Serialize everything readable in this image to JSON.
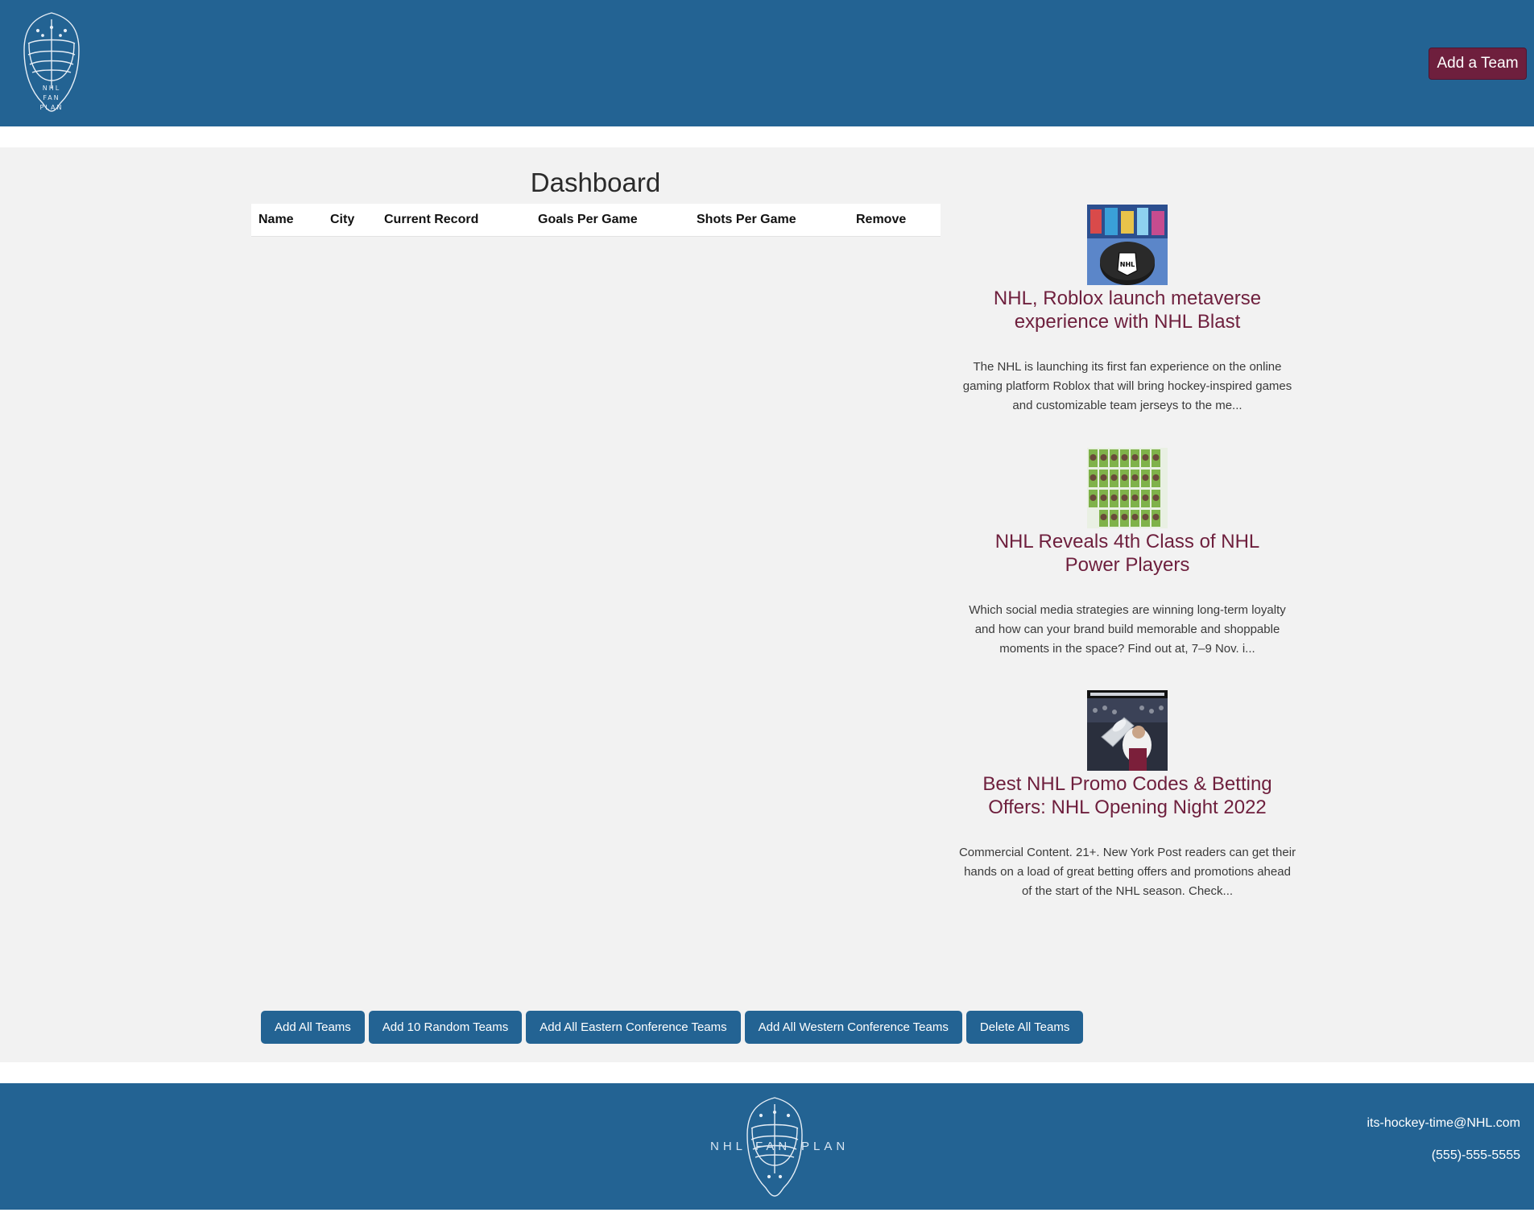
{
  "header": {
    "logo_text": [
      "NHL",
      "FAN",
      "PLAN"
    ],
    "add_team_label": "Add a Team"
  },
  "dashboard": {
    "title": "Dashboard",
    "columns": [
      "Name",
      "City",
      "Current Record",
      "Goals Per Game",
      "Shots Per Game",
      "Remove"
    ]
  },
  "news": [
    {
      "title": "NHL, Roblox launch metaverse experience with NHL Blast",
      "description": "The NHL is launching its first fan experience on the online gaming platform Roblox that will bring hockey-inspired games and customizable team jerseys to the me...",
      "thumb_icon": "nhl-puck-image"
    },
    {
      "title": "NHL Reveals 4th Class of NHL Power Players",
      "description": "Which social media strategies are winning long-term loyalty and how can your brand build memorable and shoppable moments in the space? Find out at, 7–9 Nov. i...",
      "thumb_icon": "player-grid-image"
    },
    {
      "title": "Best NHL Promo Codes & Betting Offers: NHL Opening Night 2022",
      "description": "Commercial Content. 21+. New York Post readers can get their hands on a load of great betting offers and promotions ahead of the start of the NHL season. Check...",
      "thumb_icon": "stanley-cup-image"
    }
  ],
  "bulk_actions": {
    "add_all": "Add All Teams",
    "add_random": "Add 10 Random Teams",
    "add_eastern": "Add All Eastern Conference Teams",
    "add_western": "Add All Western Conference Teams",
    "delete_all": "Delete All Teams"
  },
  "footer": {
    "logo_left": "NHL",
    "logo_mid": "FAN",
    "logo_right": "PLAN",
    "email": "its-hockey-time@NHL.com",
    "phone": "(555)-555-5555"
  },
  "colors": {
    "brand_blue": "#236393",
    "brand_maroon": "#6e1f3d",
    "background": "#f2f2f2"
  }
}
